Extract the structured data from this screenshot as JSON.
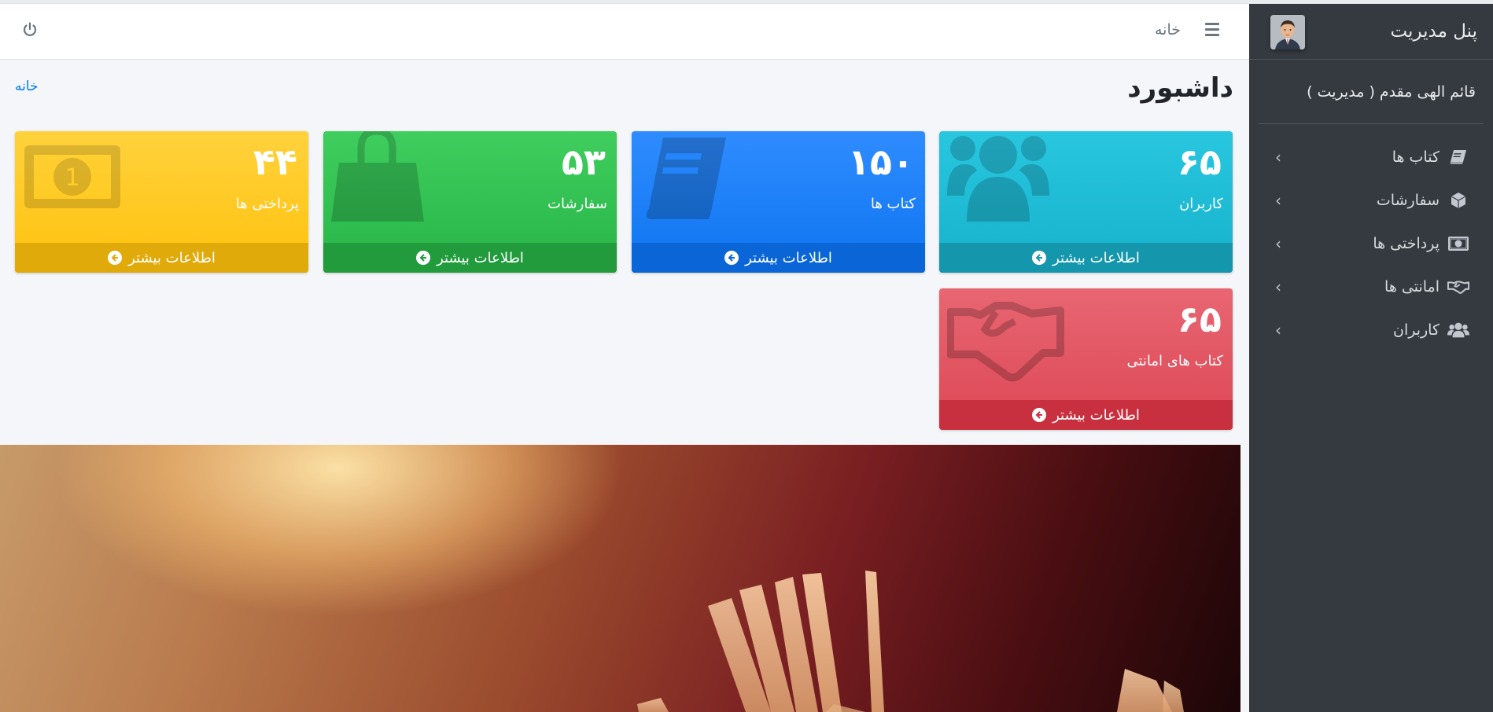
{
  "header": {
    "home_label": "خانه",
    "menu_icon": "hamburger-icon",
    "logout_icon": "power-icon"
  },
  "sidebar": {
    "brand_title": "پنل مدیریت",
    "user_name": "قائم الهی مقدم ( مدیریت )",
    "items": [
      {
        "label": "کتاب ها",
        "icon": "book-icon"
      },
      {
        "label": "سفارشات",
        "icon": "cube-icon"
      },
      {
        "label": "پرداختی ها",
        "icon": "money-bill-icon"
      },
      {
        "label": "امانتی ها",
        "icon": "handshake-icon"
      },
      {
        "label": "کاربران",
        "icon": "users-icon"
      }
    ]
  },
  "content": {
    "title": "داشبورد",
    "breadcrumb": "خانه"
  },
  "cards": [
    {
      "number": "۶۵",
      "label": "کاربران",
      "more": "اطلاعات بیشتر",
      "color": "#17b6cf",
      "icon": "users-icon"
    },
    {
      "number": "۱۵۰",
      "label": "کتاب ها",
      "more": "اطلاعات بیشتر",
      "color": "#147ef5",
      "icon": "book-icon"
    },
    {
      "number": "۵۳",
      "label": "سفارشات",
      "more": "اطلاعات بیشتر",
      "color": "#2dbb4f",
      "icon": "shopping-bag-icon"
    },
    {
      "number": "۴۴",
      "label": "پرداختی ها",
      "more": "اطلاعات بیشتر",
      "color": "#ffc513",
      "icon": "money-bill-icon"
    },
    {
      "number": "۶۵",
      "label": "کتاب های امانتی",
      "more": "اطلاعات بیشتر",
      "color": "#df4c5a",
      "icon": "handshake-icon"
    }
  ]
}
